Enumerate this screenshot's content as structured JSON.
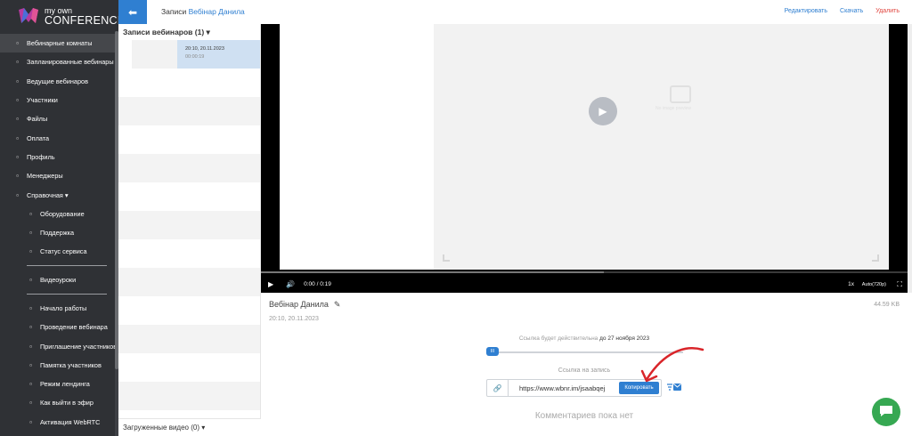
{
  "app": {
    "logo_line1": "my own",
    "logo_line2": "CONFERENCE"
  },
  "sidebar": {
    "items": [
      {
        "label": "Вебинарные комнаты",
        "icon": "webinar-room-icon",
        "active": true
      },
      {
        "label": "Запланированные вебинары",
        "icon": "calendar-icon"
      },
      {
        "label": "Ведущие вебинаров",
        "icon": "host-icon"
      },
      {
        "label": "Участники",
        "icon": "users-icon"
      },
      {
        "label": "Файлы",
        "icon": "files-icon"
      },
      {
        "label": "Оплата",
        "icon": "card-icon"
      },
      {
        "label": "Профиль",
        "icon": "profile-icon"
      },
      {
        "label": "Менеджеры",
        "icon": "managers-icon"
      },
      {
        "label": "Справочная ▾",
        "icon": "help-icon"
      }
    ],
    "help_items": [
      {
        "label": "Оборудование",
        "icon": "equipment-icon"
      },
      {
        "label": "Поддержка",
        "icon": "headset-icon"
      },
      {
        "label": "Статус сервиса",
        "icon": "status-icon"
      }
    ],
    "video_item": {
      "label": "Видеоуроки",
      "icon": "video-icon"
    },
    "guide_items": [
      {
        "label": "Начало работы",
        "icon": "doc-icon"
      },
      {
        "label": "Проведение вебинара",
        "icon": "doc-icon"
      },
      {
        "label": "Приглашение участников",
        "icon": "doc-icon"
      },
      {
        "label": "Памятка участников",
        "icon": "doc-icon"
      },
      {
        "label": "Режим лендинга",
        "icon": "doc-icon"
      },
      {
        "label": "Как выйти в эфир",
        "icon": "doc-icon"
      },
      {
        "label": "Активация WebRTC",
        "icon": "doc-icon"
      }
    ]
  },
  "header": {
    "back_icon": "arrow-left-icon",
    "crumb_prefix": "Записи",
    "crumb_link": "Вебінар Данила",
    "edit": "Редактировать",
    "download": "Скачать",
    "delete": "Удалить"
  },
  "recordings": {
    "title": "Записи вебинаров (1) ▾",
    "items": [
      {
        "datetime": "20:10, 20.11.2023",
        "duration": "00:00:19"
      }
    ],
    "loaded_title": "Загруженные видео (0) ▾"
  },
  "player": {
    "time": "0:00 / 0:19",
    "speed": "1x",
    "quality": "Auto(720p)",
    "placeholder_text": "No image preview",
    "progress_buffered": 0.53
  },
  "record": {
    "name": "Вебінар Данила",
    "date": "20:10, 20.11.2023",
    "size": "44.59 KB",
    "valid_prefix": "Ссылка будет действительна",
    "valid_until": "до 27 ноября 2023",
    "slider_label": "III",
    "link_label": "Ссылка на запись",
    "url": "https://www.wbnr.im/jsaabqej",
    "copy": "Копировать",
    "no_comments": "Комментариев пока нет"
  },
  "colors": {
    "sidebar_bg": "#2f3135",
    "accent": "#2f7fd1",
    "danger": "#e0443d",
    "chat": "#36a852",
    "annotation_arrow": "#d9252a"
  }
}
